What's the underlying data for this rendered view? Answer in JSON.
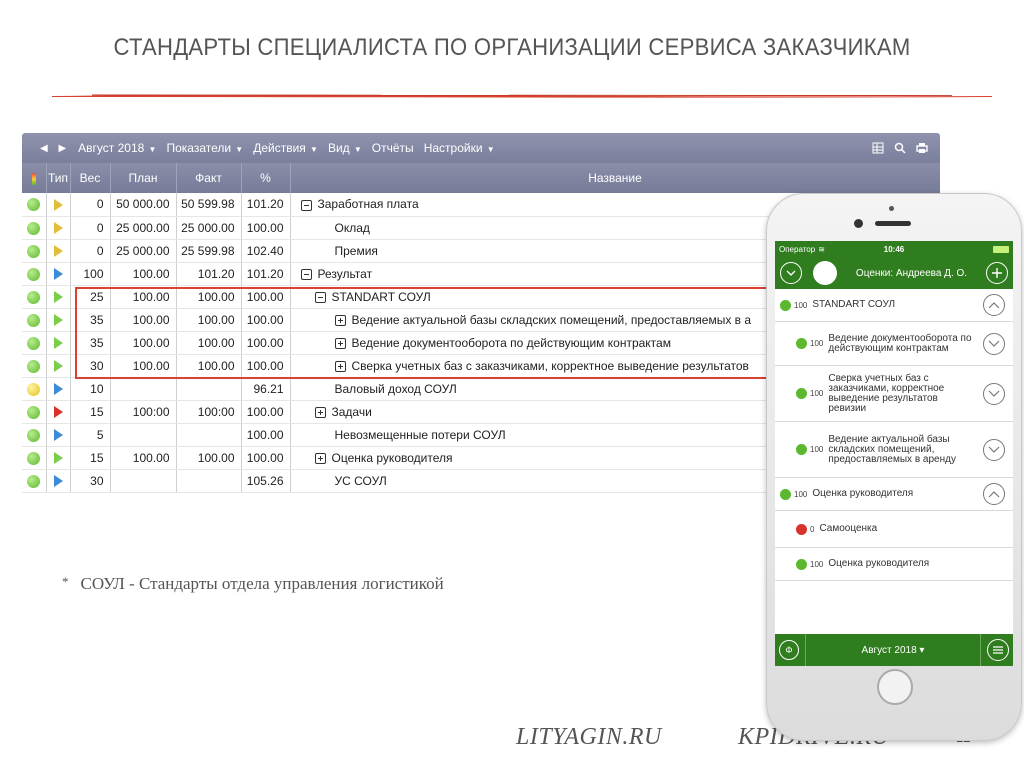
{
  "slide": {
    "title": "СТАНДАРТЫ СПЕЦИАЛИСТА ПО ОРГАНИЗАЦИИ СЕРВИСА ЗАКАЗЧИКАМ",
    "footnote_marker": "*",
    "footnote": "СОУЛ - Стандарты отдела управления логистикой",
    "footer_left": "LITYAGIN.RU",
    "footer_right": "KPIDRIVE.RU",
    "page_number": "12",
    "accent_color": "#d9422f"
  },
  "toolbar": {
    "period": "Август 2018",
    "menus": [
      "Показатели",
      "Действия",
      "Вид",
      "Отчёты",
      "Настройки"
    ],
    "icons": [
      "grid-icon",
      "search-icon",
      "print-icon"
    ]
  },
  "table": {
    "headers": [
      "Тип",
      "Вес",
      "План",
      "Факт",
      "%",
      "Название"
    ],
    "rows": [
      {
        "status": "green",
        "type": "gold",
        "weight": "0",
        "plan": "50 000.00",
        "fact": "50 599.98",
        "pct": "101.20",
        "name": "Заработная плата",
        "expander": "minus",
        "indent": 0
      },
      {
        "status": "green",
        "type": "gold",
        "weight": "0",
        "plan": "25 000.00",
        "fact": "25 000.00",
        "pct": "100.00",
        "name": "Оклад",
        "expander": "",
        "indent": 1
      },
      {
        "status": "green",
        "type": "gold",
        "weight": "0",
        "plan": "25 000.00",
        "fact": "25 599.98",
        "pct": "102.40",
        "name": "Премия",
        "expander": "",
        "indent": 1
      },
      {
        "status": "green",
        "type": "blue",
        "weight": "100",
        "plan": "100.00",
        "fact": "101.20",
        "pct": "101.20",
        "name": "Результат",
        "expander": "minus",
        "indent": 0
      },
      {
        "status": "green",
        "type": "green",
        "weight": "25",
        "plan": "100.00",
        "fact": "100.00",
        "pct": "100.00",
        "name": "STANDART СОУЛ",
        "expander": "minus",
        "indent": 1
      },
      {
        "status": "green",
        "type": "green",
        "weight": "35",
        "plan": "100.00",
        "fact": "100.00",
        "pct": "100.00",
        "name": "Ведение актуальной базы складских помещений, предоставляемых в а",
        "expander": "plus",
        "indent": 2
      },
      {
        "status": "green",
        "type": "green",
        "weight": "35",
        "plan": "100.00",
        "fact": "100.00",
        "pct": "100.00",
        "name": "Ведение документооборота по действующим контрактам",
        "expander": "plus",
        "indent": 2
      },
      {
        "status": "green",
        "type": "green",
        "weight": "30",
        "plan": "100.00",
        "fact": "100.00",
        "pct": "100.00",
        "name": "Сверка учетных баз с заказчиками, корректное выведение результатов",
        "expander": "plus",
        "indent": 2
      },
      {
        "status": "yellow",
        "type": "blue",
        "weight": "10",
        "plan": "",
        "fact": "",
        "pct": "96.21",
        "name": "Валовый доход СОУЛ",
        "expander": "",
        "indent": 1
      },
      {
        "status": "green",
        "type": "red",
        "weight": "15",
        "plan": "100:00",
        "fact": "100:00",
        "pct": "100.00",
        "name": "Задачи",
        "expander": "plus",
        "indent": 1
      },
      {
        "status": "green",
        "type": "blue",
        "weight": "5",
        "plan": "",
        "fact": "",
        "pct": "100.00",
        "name": "Невозмещенные потери СОУЛ",
        "expander": "",
        "indent": 1
      },
      {
        "status": "green",
        "type": "green",
        "weight": "15",
        "plan": "100.00",
        "fact": "100.00",
        "pct": "100.00",
        "name": "Оценка руководителя",
        "expander": "plus",
        "indent": 1
      },
      {
        "status": "green",
        "type": "blue",
        "weight": "30",
        "plan": "",
        "fact": "",
        "pct": "105.26",
        "name": "УС СОУЛ",
        "expander": "",
        "indent": 1
      }
    ]
  },
  "mobile": {
    "carrier": "Оператор",
    "time": "10:46",
    "header_title": "Оценки: Андреева Д. О.",
    "items": [
      {
        "status": "green",
        "value": "100",
        "text": "STANDART СОУЛ",
        "chevron": "up",
        "indent": 0
      },
      {
        "status": "green",
        "value": "100",
        "text": "Ведение документооборота по действующим контрактам",
        "chevron": "down",
        "indent": 1
      },
      {
        "status": "green",
        "value": "100",
        "text": "Сверка учетных баз с заказчиками, корректное выведение результатов ревизии",
        "chevron": "down",
        "indent": 1
      },
      {
        "status": "green",
        "value": "100",
        "text": "Ведение актуальной базы складских помещений, предоставляемых в аренду",
        "chevron": "down",
        "indent": 1
      },
      {
        "status": "green",
        "value": "100",
        "text": "Оценка руководителя",
        "chevron": "up",
        "indent": 0
      },
      {
        "status": "red",
        "value": "0",
        "text": "Самооценка",
        "chevron": "",
        "indent": 1
      },
      {
        "status": "green",
        "value": "100",
        "text": "Оценка руководителя",
        "chevron": "",
        "indent": 1
      }
    ],
    "footer_period": "Август 2018",
    "footer_left_icon": "f-circle-icon",
    "footer_right_icon": "menu-icon"
  }
}
